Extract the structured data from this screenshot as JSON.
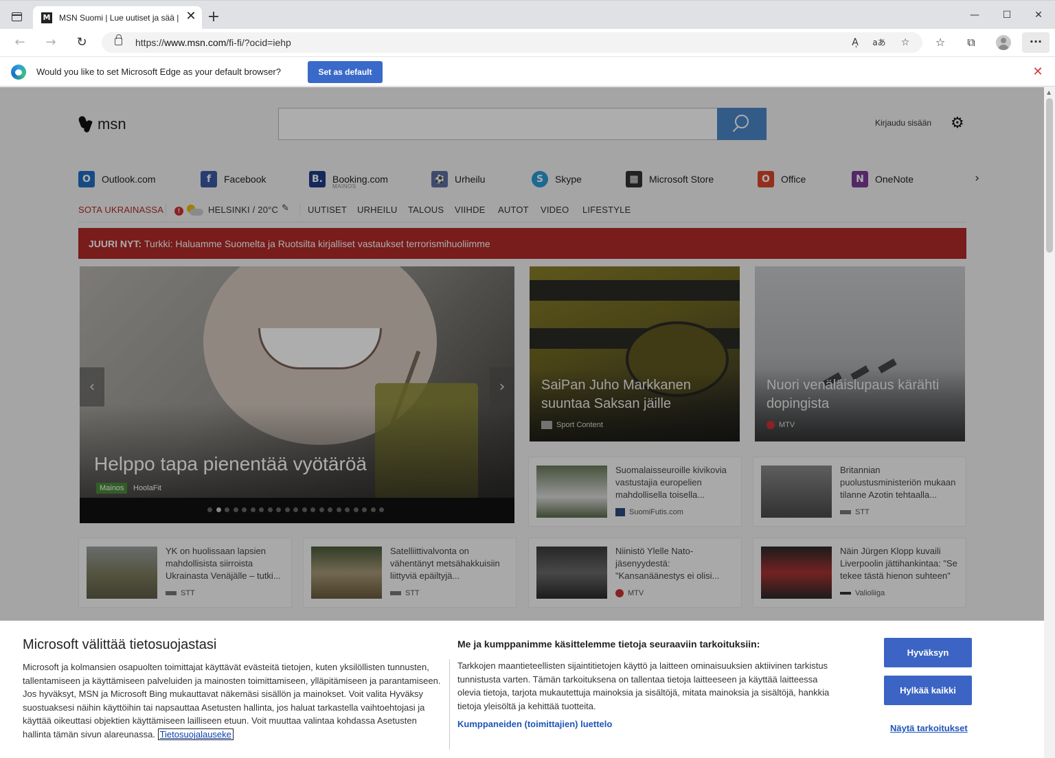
{
  "browser": {
    "tab_title": "MSN Suomi | Lue uutiset ja sää |",
    "tab_favicon": "M",
    "tab_close": "✕",
    "new_tab": "+",
    "window": {
      "minimize": "—",
      "maximize": "☐",
      "close": "✕"
    },
    "url_prefix": "https://",
    "url_host": "www.msn.com",
    "url_path": "/fi-fi/?ocid=iehp",
    "toolbar_icons": [
      "read-aloud-icon",
      "translate-icon",
      "add-favorite-icon",
      "favorites-icon",
      "collections-icon",
      "profile-icon",
      "more-icon"
    ],
    "read_aloud_glyph": "Aͅ",
    "translate_glyph": "aあ",
    "more_glyph": "···"
  },
  "infobar": {
    "text": "Would you like to set Microsoft Edge as your default browser?",
    "button": "Set as default"
  },
  "msn": {
    "logo_text": "msn",
    "signin": "Kirjaudu sisään",
    "quicklinks": [
      {
        "label": "Outlook.com",
        "icon": "outlook-icon",
        "glyph": "O",
        "color": "#1f6fc5"
      },
      {
        "label": "Facebook",
        "icon": "facebook-icon",
        "glyph": "f",
        "color": "#3b5ba4"
      },
      {
        "label": "Booking.com",
        "sub": "MAINOS",
        "icon": "booking-icon",
        "glyph": "B.",
        "color": "#1d3b86"
      },
      {
        "label": "Urheilu",
        "icon": "sports-icon",
        "glyph": "⚽",
        "color": "#5a6fa3"
      },
      {
        "label": "Skype",
        "icon": "skype-icon",
        "glyph": "S",
        "color": "#2a9bd8"
      },
      {
        "label": "Microsoft Store",
        "icon": "store-icon",
        "glyph": "▦",
        "color": "#333333"
      },
      {
        "label": "Office",
        "icon": "office-icon",
        "glyph": "O",
        "color": "#d9482b"
      },
      {
        "label": "OneNote",
        "icon": "onenote-icon",
        "glyph": "N",
        "color": "#7c3a9a"
      }
    ],
    "nav": {
      "war": "SOTA UKRAINASSA",
      "weather": "HELSINKI / 20°C",
      "items": [
        "UUTISET",
        "URHEILU",
        "TALOUS",
        "VIIHDE",
        "AUTOT",
        "VIDEO",
        "LIFESTYLE"
      ]
    },
    "breaking": {
      "label": "JUURI NYT:",
      "text": "Turkki: Haluamme Suomelta ja Ruotsilta kirjalliset vastaukset terrorismihuoliimme"
    },
    "hero": {
      "title": "Helppo tapa pienentää vyötäröä",
      "badge": "Mainos",
      "source": "HoolaFit",
      "dots_count": 21,
      "active_dot": 1
    },
    "cards": [
      {
        "title": "SaiPan Juho Markkanen suuntaa Saksan jäille",
        "source": "Sport Content"
      },
      {
        "title": "Nuori venäläislupaus kärähti dopingista",
        "source": "MTV"
      }
    ],
    "small_cards": [
      {
        "text": "Suomalaisseuroille kivikovia vastustajia europelien mahdollisella toisella...",
        "source": "SuomiFutis.com"
      },
      {
        "text": "Britannian puolustusministeriön mukaan tilanne Azotin tehtaalla...",
        "source": "STT"
      },
      {
        "text": "YK on huolissaan lapsien mahdollisista siirroista Ukrainasta Venäjälle – tutki...",
        "source": "STT"
      },
      {
        "text": "Satelliittivalvonta on vähentänyt metsähakkuisiin liittyviä epäiltyjä...",
        "source": "STT"
      },
      {
        "text": "Niinistö Ylelle Nato-jäsenyydestä: \"Kansanäänestys ei olisi...",
        "source": "MTV"
      },
      {
        "text": "Näin Jürgen Klopp kuvaili Liverpoolin jättihankintaa: \"Se tekee tästä hienon suhteen\"",
        "source": "Valioliiga"
      }
    ]
  },
  "consent": {
    "title": "Microsoft välittää tietosuojastasi",
    "body": "Microsoft ja kolmansien osapuolten toimittajat käyttävät evästeitä tietojen, kuten yksilöllisten tunnusten, tallentamiseen ja käyttämiseen palveluiden ja mainosten toimittamiseen, ylläpitämiseen ja parantamiseen. Jos hyväksyt, MSN ja Microsoft Bing mukauttavat näkemäsi sisällön ja mainokset. Voit valita Hyväksy suostuaksesi näihin käyttöihin tai napsauttaa Asetusten hallinta, jos haluat tarkastella vaihtoehtojasi ja käyttää oikeuttasi objektien käyttämiseen lailliseen etuun. Voit muuttaa valintaa kohdassa Asetusten hallinta tämän sivun alareunassa.",
    "privacy_link": "Tietosuojalauseke",
    "purposes_heading": "Me ja kumppanimme käsittelemme tietoja seuraaviin tarkoituksiin:",
    "purposes_text": "Tarkkojen maantieteellisten sijaintitietojen käyttö ja laitteen ominaisuuksien aktiivinen tarkistus tunnistusta varten. Tämän tarkoituksena on tallentaa tietoja laitteeseen ja käyttää laitteessa olevia tietoja, tarjota mukautettuja mainoksia ja sisältöjä, mitata mainoksia ja sisältöjä, hankkia tietoja yleisöltä ja kehittää tuotteita.",
    "partners_link": "Kumppaneiden (toimittajien) luettelo",
    "accept": "Hyväksyn",
    "reject": "Hylkää kaikki",
    "show_purposes": "Näytä tarkoitukset"
  }
}
